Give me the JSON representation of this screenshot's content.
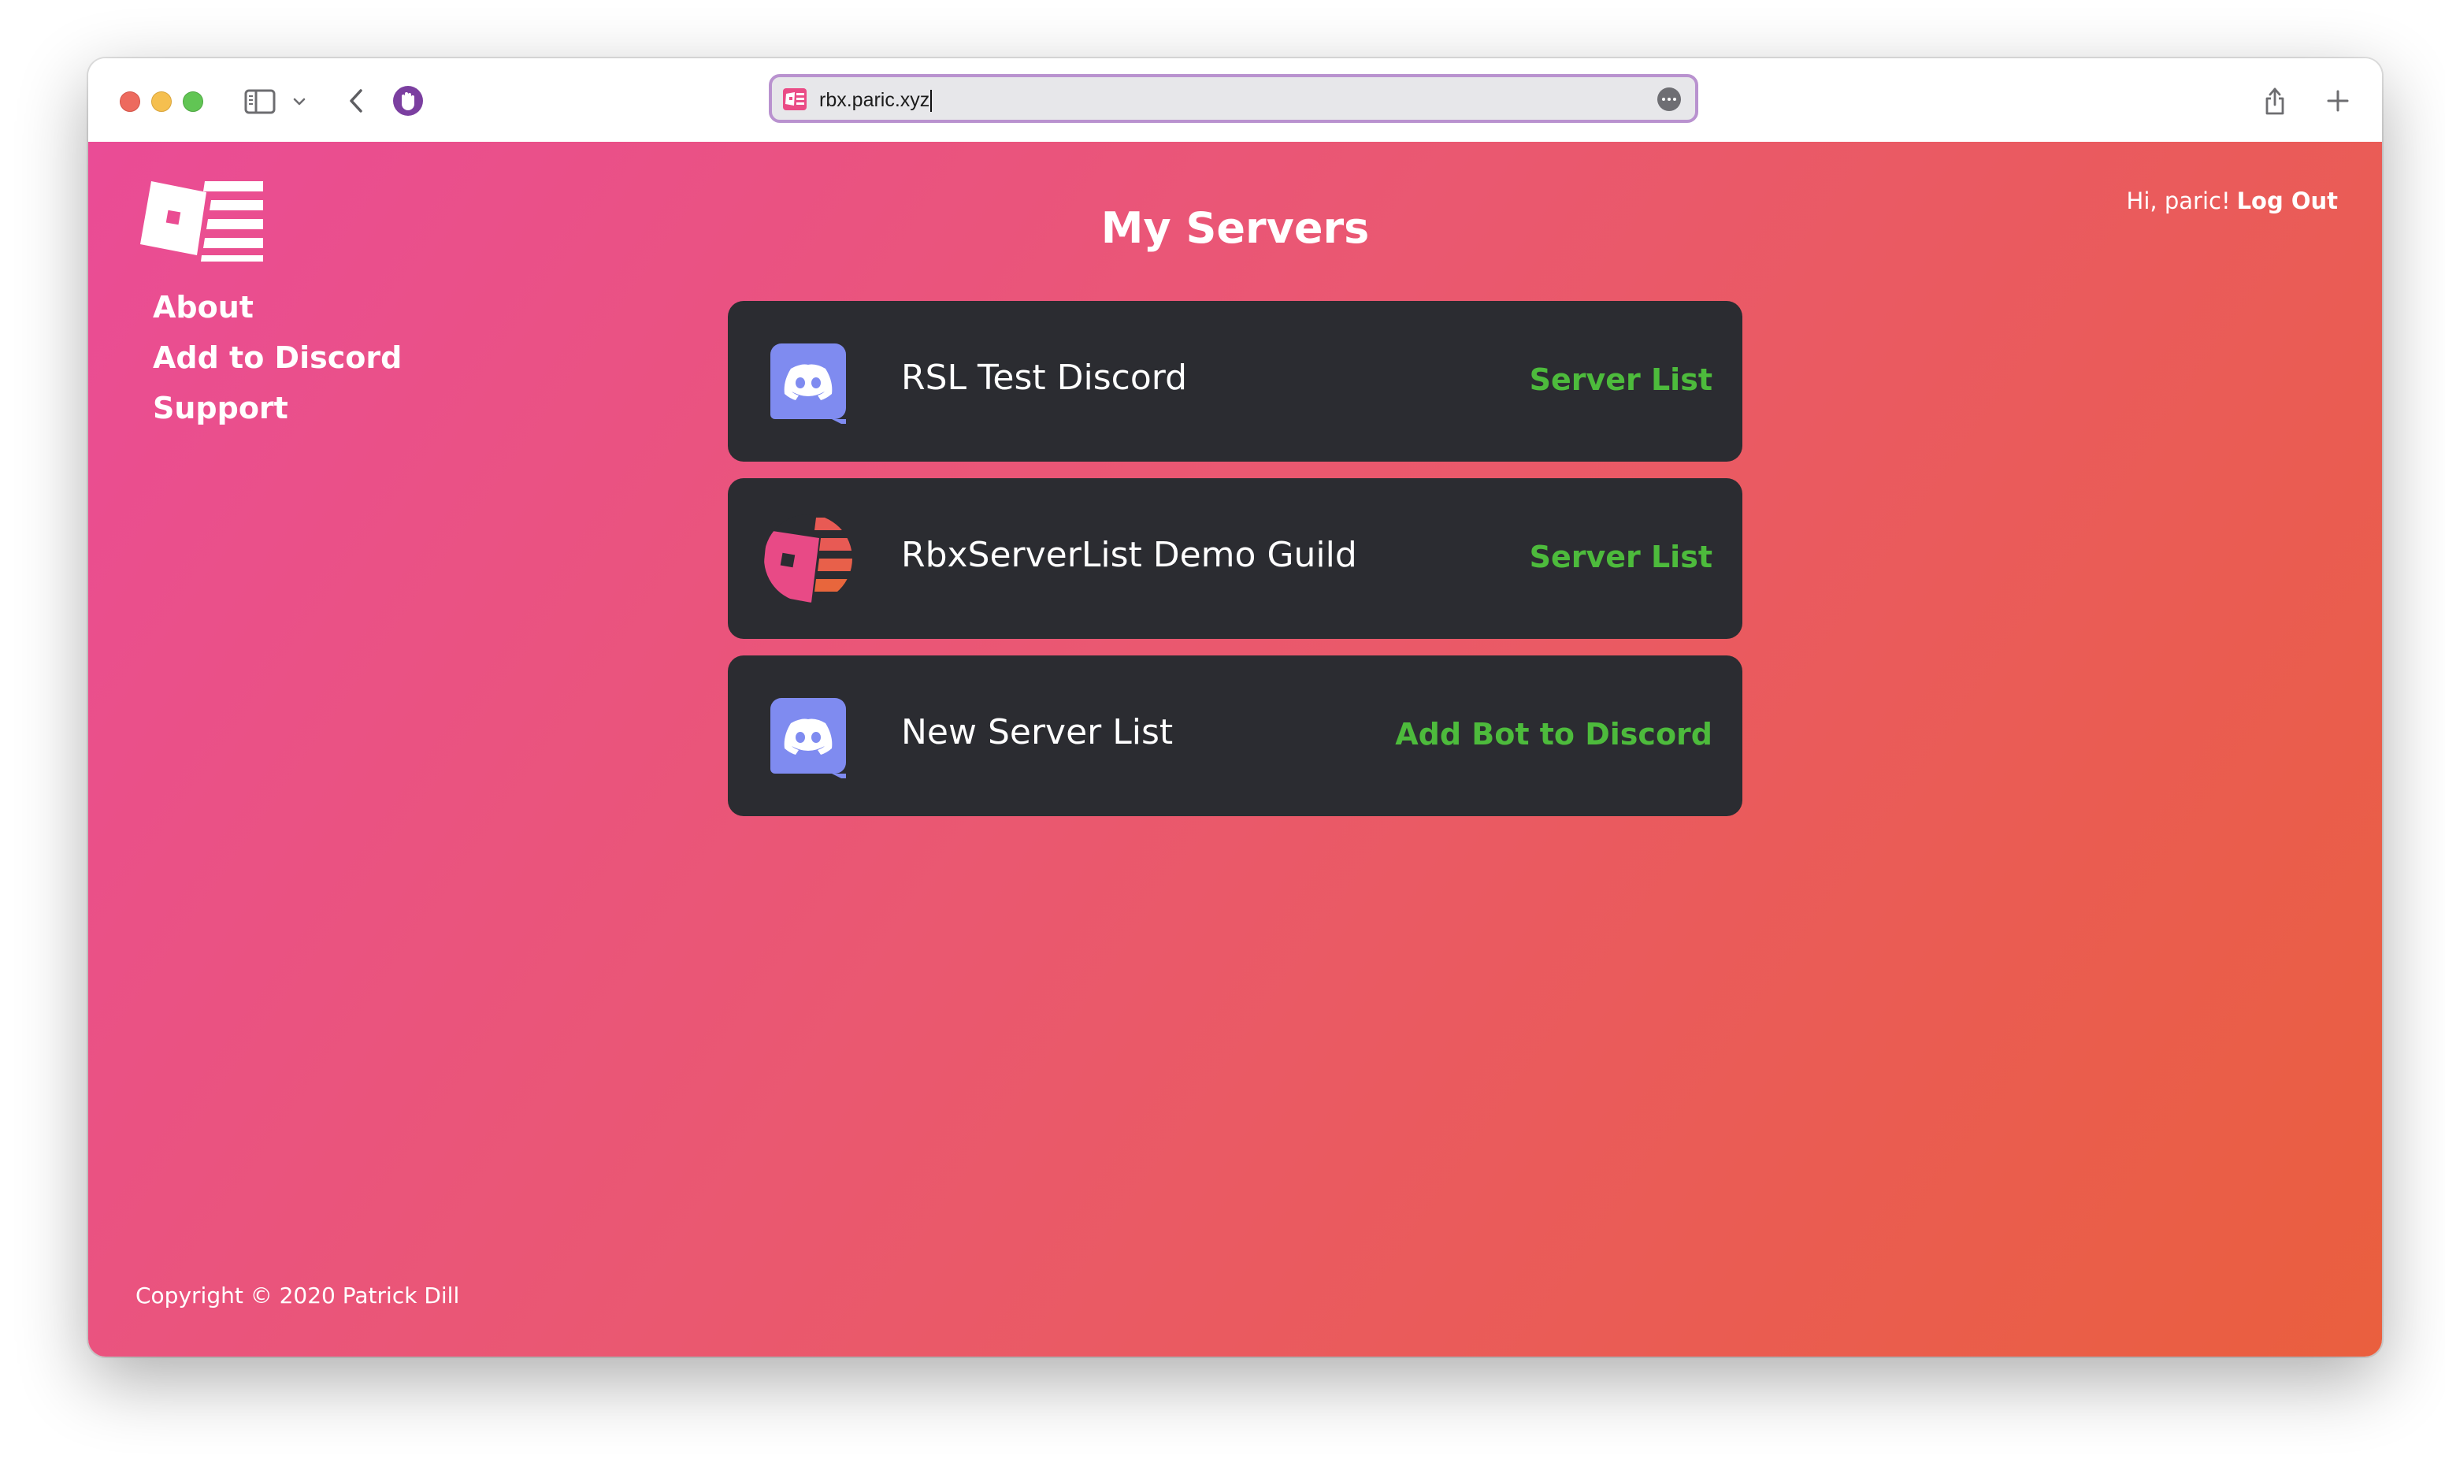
{
  "browser": {
    "url": "rbx.paric.xyz",
    "icons": {
      "sidebar_toggle": "sidebar-icon",
      "sidebar_menu": "chevron-down-icon",
      "back": "chevron-left-icon",
      "extension": "hand-stop-icon",
      "page_menu": "ellipsis-icon",
      "share": "share-icon",
      "new_tab": "plus-icon"
    }
  },
  "site": {
    "nav": [
      {
        "label": "About"
      },
      {
        "label": "Add to Discord"
      },
      {
        "label": "Support"
      }
    ],
    "greeting": "Hi, paric!",
    "logout_label": "Log Out",
    "page_title": "My Servers",
    "copyright": "Copyright © 2020 Patrick Dill"
  },
  "servers": [
    {
      "name": "RSL Test Discord",
      "action": "Server List",
      "icon": "discord-icon"
    },
    {
      "name": "RbxServerList Demo Guild",
      "action": "Server List",
      "icon": "rbxserverlist-logo-icon"
    },
    {
      "name": "New Server List",
      "action": "Add Bot to Discord",
      "icon": "discord-icon"
    }
  ],
  "colors": {
    "gradient_start": "#ea4c96",
    "gradient_end": "#ea5f3e",
    "card_background": "#2b2c31",
    "action_green": "#4dbb3c",
    "discord_blurple": "#7f8bf0"
  }
}
